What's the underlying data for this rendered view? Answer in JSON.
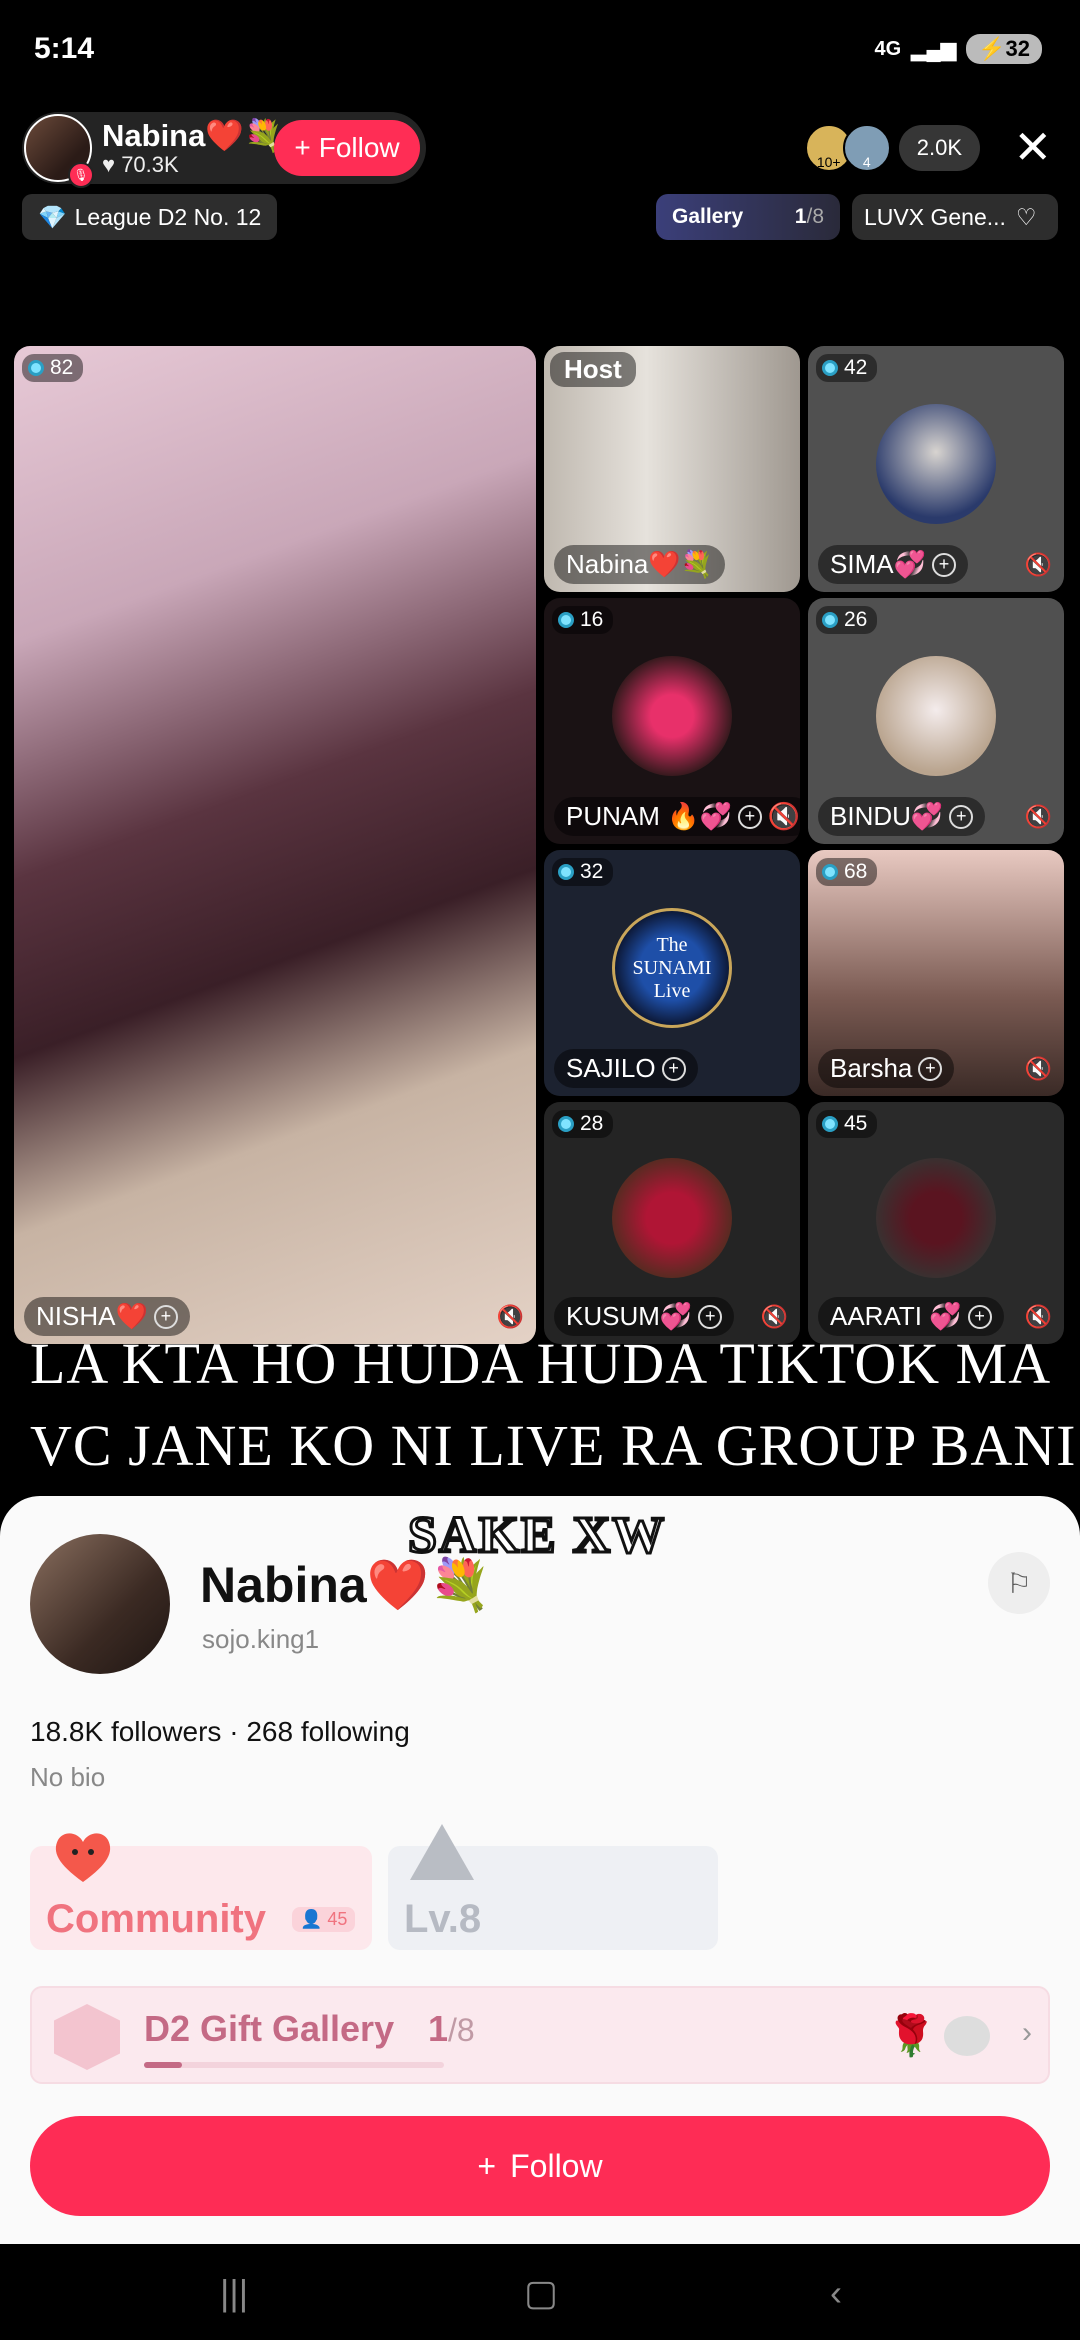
{
  "status": {
    "time": "5:14",
    "network": "4G",
    "battery": "32"
  },
  "host": {
    "name": "Nabina❤️💐",
    "likes": "70.3K",
    "follow_label": "Follow",
    "league": "League D2 No. 12"
  },
  "viewers": {
    "count": "2.0K",
    "badges": [
      "10+",
      "4"
    ]
  },
  "gallery": {
    "label": "Gallery",
    "current": "1",
    "total": "/8"
  },
  "luvx": {
    "label": "LUVX Gene..."
  },
  "tiles": [
    {
      "name": "NISHA❤️",
      "count": "82"
    },
    {
      "host_tag": "Host",
      "name": "Nabina❤️💐"
    },
    {
      "name": "SIMA💞",
      "count": "42"
    },
    {
      "name": "PUNAM 🔥💞",
      "count": "16"
    },
    {
      "name": "BINDU💞",
      "count": "26"
    },
    {
      "name": "SAJILO",
      "count": "32",
      "logo": "The SUNAMI Live"
    },
    {
      "name": "Barsha",
      "count": "68"
    },
    {
      "name": "KUSUM💞",
      "count": "28"
    },
    {
      "name": "AARATI 💞",
      "count": "45"
    }
  ],
  "overlay": {
    "line1": "LA KTA HO HUDA HUDA TIKTOK MA",
    "line2": "VC JANE KO NI LIVE RA GROUP BANI",
    "line3": "SAKE XW"
  },
  "profile": {
    "name": "Nabina❤️💐",
    "handle": "sojo.king1",
    "stats": "18.8K followers · 268 following",
    "bio": "No bio",
    "community_label": "Community",
    "community_count": "45",
    "level_label": "Lv.8",
    "gift_gallery_label": "D2 Gift Gallery",
    "gift_gallery_current": "1",
    "gift_gallery_total": "/8",
    "gift_gallery_progress": 0.125,
    "follow_label": "Follow"
  },
  "colors": {
    "accent": "#fe2c55",
    "community": "#f0737f",
    "gift": "#c46a85"
  }
}
